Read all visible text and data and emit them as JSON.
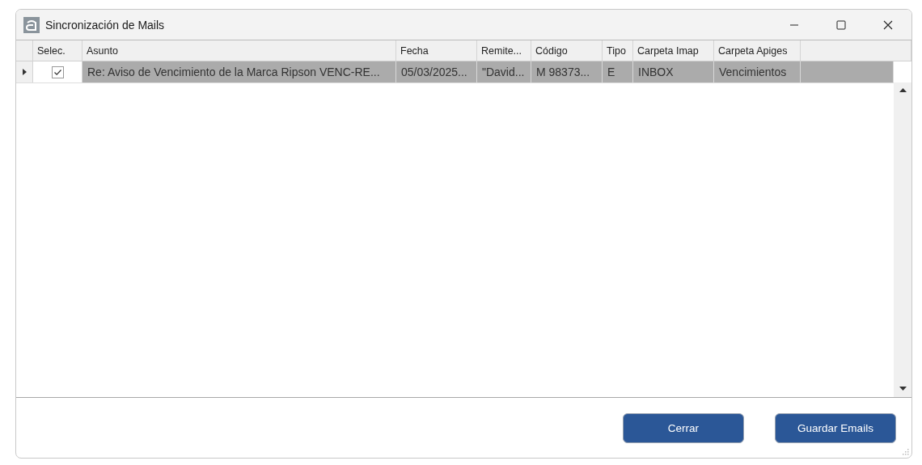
{
  "window": {
    "title": "Sincronización de Mails"
  },
  "table": {
    "check_column": "Selec.",
    "columns": [
      "Asunto",
      "Fecha",
      "Remite...",
      "Código",
      "Tipo",
      "Carpeta Imap",
      "Carpeta Apiges"
    ],
    "rows": [
      {
        "selected": true,
        "current": true,
        "checked": true,
        "cells": [
          "Re: Aviso de Vencimiento de la Marca Ripson VENC-RE...",
          "05/03/2025...",
          "\"David...",
          "M 98373...",
          "E",
          "INBOX",
          "Vencimientos"
        ]
      }
    ]
  },
  "buttons": [
    "Cerrar",
    "Guardar Emails"
  ]
}
